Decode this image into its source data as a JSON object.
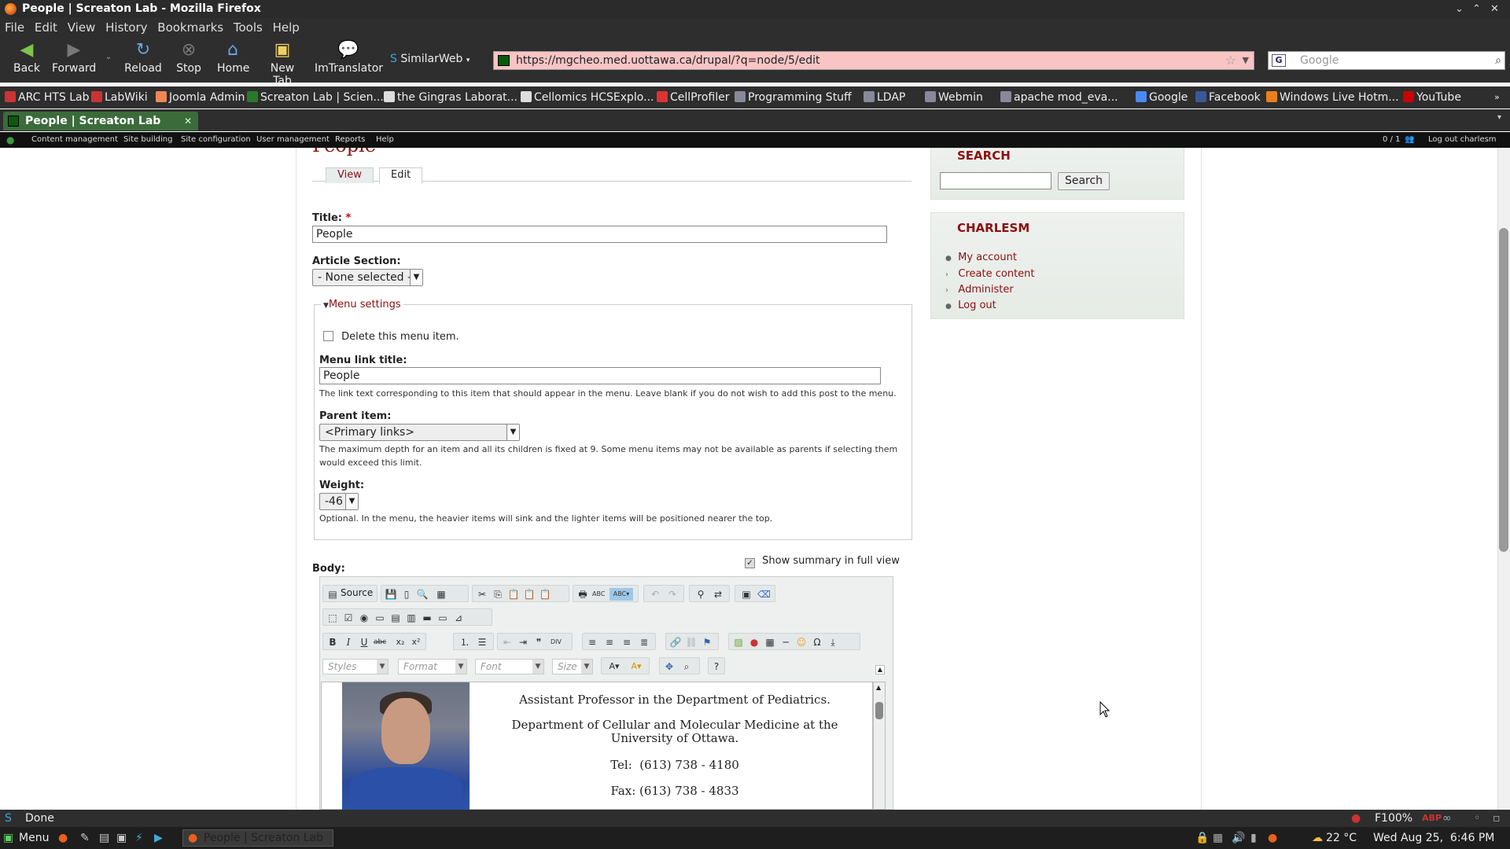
{
  "window": {
    "title": "People | Screaton Lab - Mozilla Firefox"
  },
  "menubar": [
    "File",
    "Edit",
    "View",
    "History",
    "Bookmarks",
    "Tools",
    "Help"
  ],
  "nav": {
    "back": "Back",
    "forward": "Forward",
    "reload": "Reload",
    "stop": "Stop",
    "home": "Home",
    "newtab": "New Tab",
    "imtranslator": "ImTranslator",
    "similarweb": "SimilarWeb"
  },
  "url": "https://mgcheo.med.uottawa.ca/drupal/?q=node/5/edit",
  "search_placeholder": "Google",
  "bookmarks": [
    "ARC HTS Lab",
    "LabWiki",
    "Joomla Admin",
    "Screaton Lab | Scien...",
    "the Gingras Laborat...",
    "Cellomics HCSExplo...",
    "CellProfiler",
    "Programming Stuff",
    "LDAP",
    "Webmin",
    "apache mod_eva...",
    "Google",
    "Facebook",
    "Windows Live Hotm...",
    "YouTube"
  ],
  "tab": {
    "title": "People | Screaton Lab"
  },
  "adminbar": {
    "items": [
      "Content management",
      "Site building",
      "Site configuration",
      "User management",
      "Reports",
      "Help"
    ],
    "users": "0 / 1",
    "logout": "Log out charlesm"
  },
  "page": {
    "heading": "People",
    "tabs": [
      "View",
      "Edit"
    ],
    "title_label": "Title:",
    "required_mark": "*",
    "title_value": "People",
    "section_label": "Article Section:",
    "section_value": "- None selected -",
    "menu_legend": "Menu settings",
    "delete_label": "Delete this menu item.",
    "menu_link_label": "Menu link title:",
    "menu_link_value": "People",
    "menu_link_desc": "The link text corresponding to this item that should appear in the menu. Leave blank if you do not wish to add this post to the menu.",
    "parent_label": "Parent item:",
    "parent_value": "<Primary links>",
    "parent_desc": "The maximum depth for an item and all its children is fixed at 9. Some menu items may not be available as parents if selecting them would exceed this limit.",
    "weight_label": "Weight:",
    "weight_value": "-46",
    "weight_desc": "Optional. In the menu, the heavier items will sink and the lighter items will be positioned nearer the top.",
    "body_label": "Body:",
    "summary_label": "Show summary in full view",
    "source_label": "Source",
    "combos": [
      "Styles",
      "Format",
      "Font",
      "Size"
    ],
    "body_lines": [
      "Assistant Professor in the Department of Pediatrics.",
      "Department of Cellular and Molecular Medicine at the University of Ottawa.",
      "Tel:  (613) 738 - 4180",
      "Fax: (613) 738 - 4833"
    ]
  },
  "sidebar": {
    "search_title": "SEARCH",
    "search_button": "Search",
    "user_title": "CHARLESM",
    "links": [
      "My account",
      "Create content",
      "Administer",
      "Log out"
    ]
  },
  "status": {
    "text": "Done",
    "zoom": "F100%"
  },
  "taskbar": {
    "menu": "Menu",
    "task": "People | Screaton Lab -...",
    "weather": "22 °C",
    "clock": "Wed Aug 25,  6:46 PM"
  }
}
